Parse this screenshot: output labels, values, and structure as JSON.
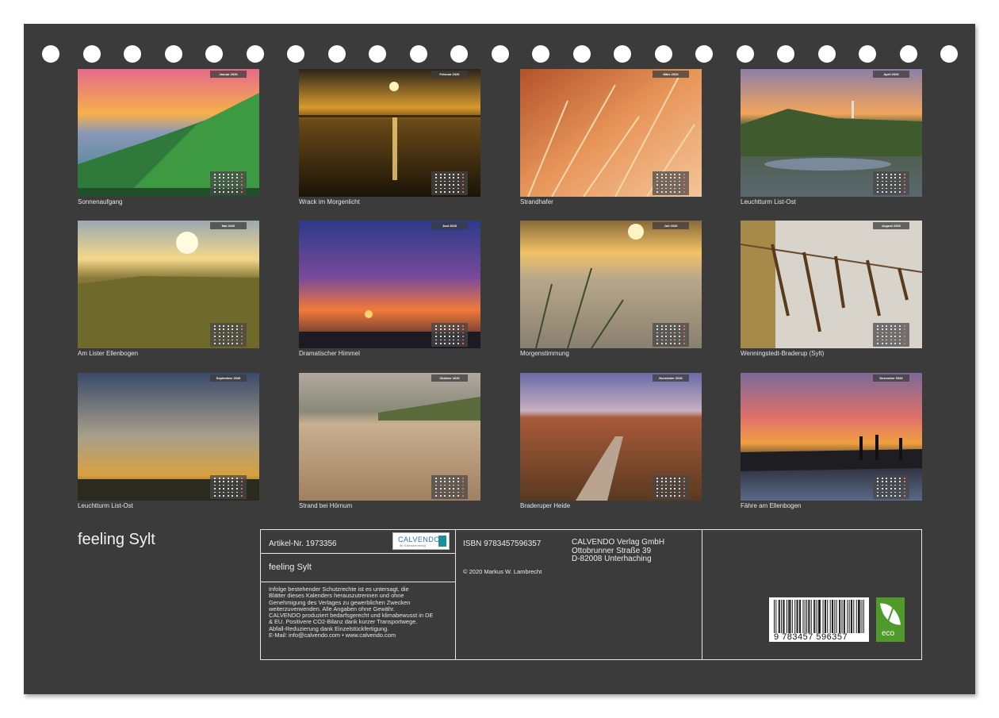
{
  "calendar": {
    "title": "feeling Sylt",
    "months": [
      {
        "month_label": "Januar 2026",
        "caption": "Sonnenaufgang"
      },
      {
        "month_label": "Februar 2026",
        "caption": "Wrack im Morgenlicht"
      },
      {
        "month_label": "März 2026",
        "caption": "Strandhafer"
      },
      {
        "month_label": "April 2026",
        "caption": "Leuchtturm List-Ost"
      },
      {
        "month_label": "Mai 2026",
        "caption": "Am Lister Ellenbogen"
      },
      {
        "month_label": "Juni 2026",
        "caption": "Dramatischer Himmel"
      },
      {
        "month_label": "Juli 2026",
        "caption": "Morgenstimmung"
      },
      {
        "month_label": "August 2026",
        "caption": "Wenningstedt-Braderup (Sylt)"
      },
      {
        "month_label": "September 2026",
        "caption": "Leuchtturm List-Ost"
      },
      {
        "month_label": "Oktober 2026",
        "caption": "Strand bei Hörnum"
      },
      {
        "month_label": "November 2026",
        "caption": "Braderuper Heide"
      },
      {
        "month_label": "Dezember 2026",
        "caption": "Fähre am Ellenbogen"
      }
    ]
  },
  "imprint": {
    "article_no": "Artikel-Nr. 1973356",
    "logo_text": "CALVENDO",
    "logo_sub": "Ihr Kalenderverlag",
    "product_title": "feeling Sylt",
    "legal_lines": [
      "Infolge bestehender Schutzrechte ist es untersagt, die",
      "Blätter dieses Kalenders herauszutrennen und ohne",
      "Genehmigung des Verlages zu gewerblichen Zwecken",
      "weiterzuverwenden. Alle Angaben ohne Gewähr.",
      "CALVENDO produziert bedarfsgerecht und klimabewusst in DE",
      "& EU. Positivere CO2-Bilanz dank kurzer Transportwege.",
      "Abfall-Reduzierung dank Einzelstückfertigung.",
      "E-Mail: info@calvendo.com • www.calvendo.com"
    ],
    "isbn": "ISBN 9783457596357",
    "copyright": "© 2020 Markus W. Lambrecht",
    "publisher_lines": [
      "CALVENDO Verlag GmbH",
      "Ottobrunner Straße 39",
      "D-82008 Unterhaching"
    ],
    "barcode_digits": "9 783457 596357",
    "eco_label": "eco"
  }
}
